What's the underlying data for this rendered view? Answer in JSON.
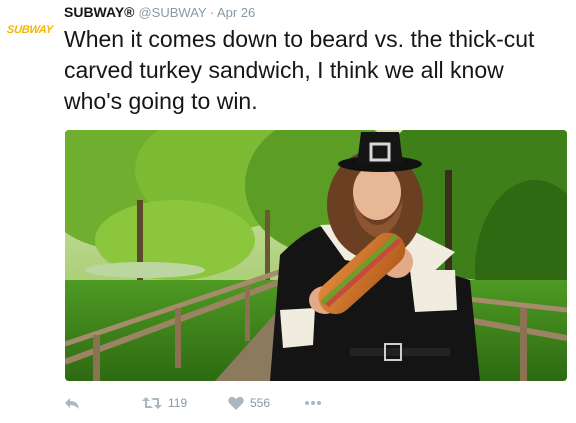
{
  "tweet": {
    "avatar_text": "SUBWAY",
    "display_name": "SUBWAY®",
    "handle": "@SUBWAY",
    "separator": "·",
    "date": "Apr 26",
    "text": "When it comes down to beard vs. the thick-cut carved turkey sandwich, I think we all know who's going to win."
  },
  "actions": {
    "retweet_count": "119",
    "like_count": "556"
  },
  "colors": {
    "brand_yellow": "#f2b705",
    "text": "#14171a",
    "muted": "#8899a6",
    "icon": "#aab8c2"
  },
  "icons": {
    "reply": "reply-icon",
    "retweet": "retweet-icon",
    "like": "heart-icon",
    "more": "more-icon"
  }
}
